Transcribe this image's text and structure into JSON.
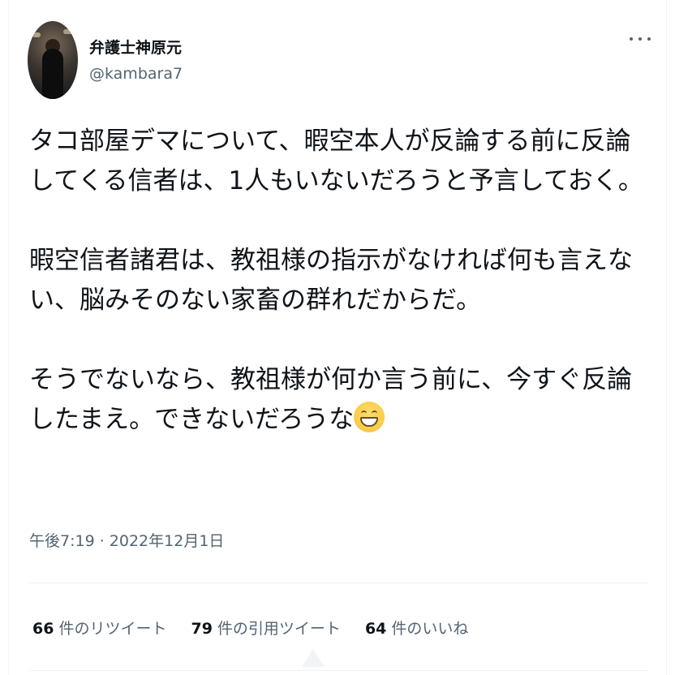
{
  "author": {
    "display_name": "弁護士神原元",
    "handle": "@kambara7"
  },
  "icons": {
    "more": "more-options-icon",
    "emoji": "grinning-face-with-smiling-eyes-emoji"
  },
  "tweet": {
    "text": "タコ部屋デマについて、暇空本人が反論する前に反論\nしてくる信者は、1人もいないだろうと予言しておく。\n\n暇空信者諸君は、教祖様の指示がなければ何も言えな\nい、脳みそのない家畜の群れだからだ。\n\nそうでないなら、教祖様が何か言う前に、今すぐ反論\nしたまえ。できないだろうな",
    "timestamp": "午後7:19 · 2022年12月1日"
  },
  "stats": [
    {
      "count": "66",
      "label": "件のリツイート"
    },
    {
      "count": "79",
      "label": "件の引用ツイート"
    },
    {
      "count": "64",
      "label": "件のいいね"
    }
  ],
  "colors": {
    "text_primary": "#0f1419",
    "text_secondary": "#536471",
    "divider": "#eff3f4"
  }
}
